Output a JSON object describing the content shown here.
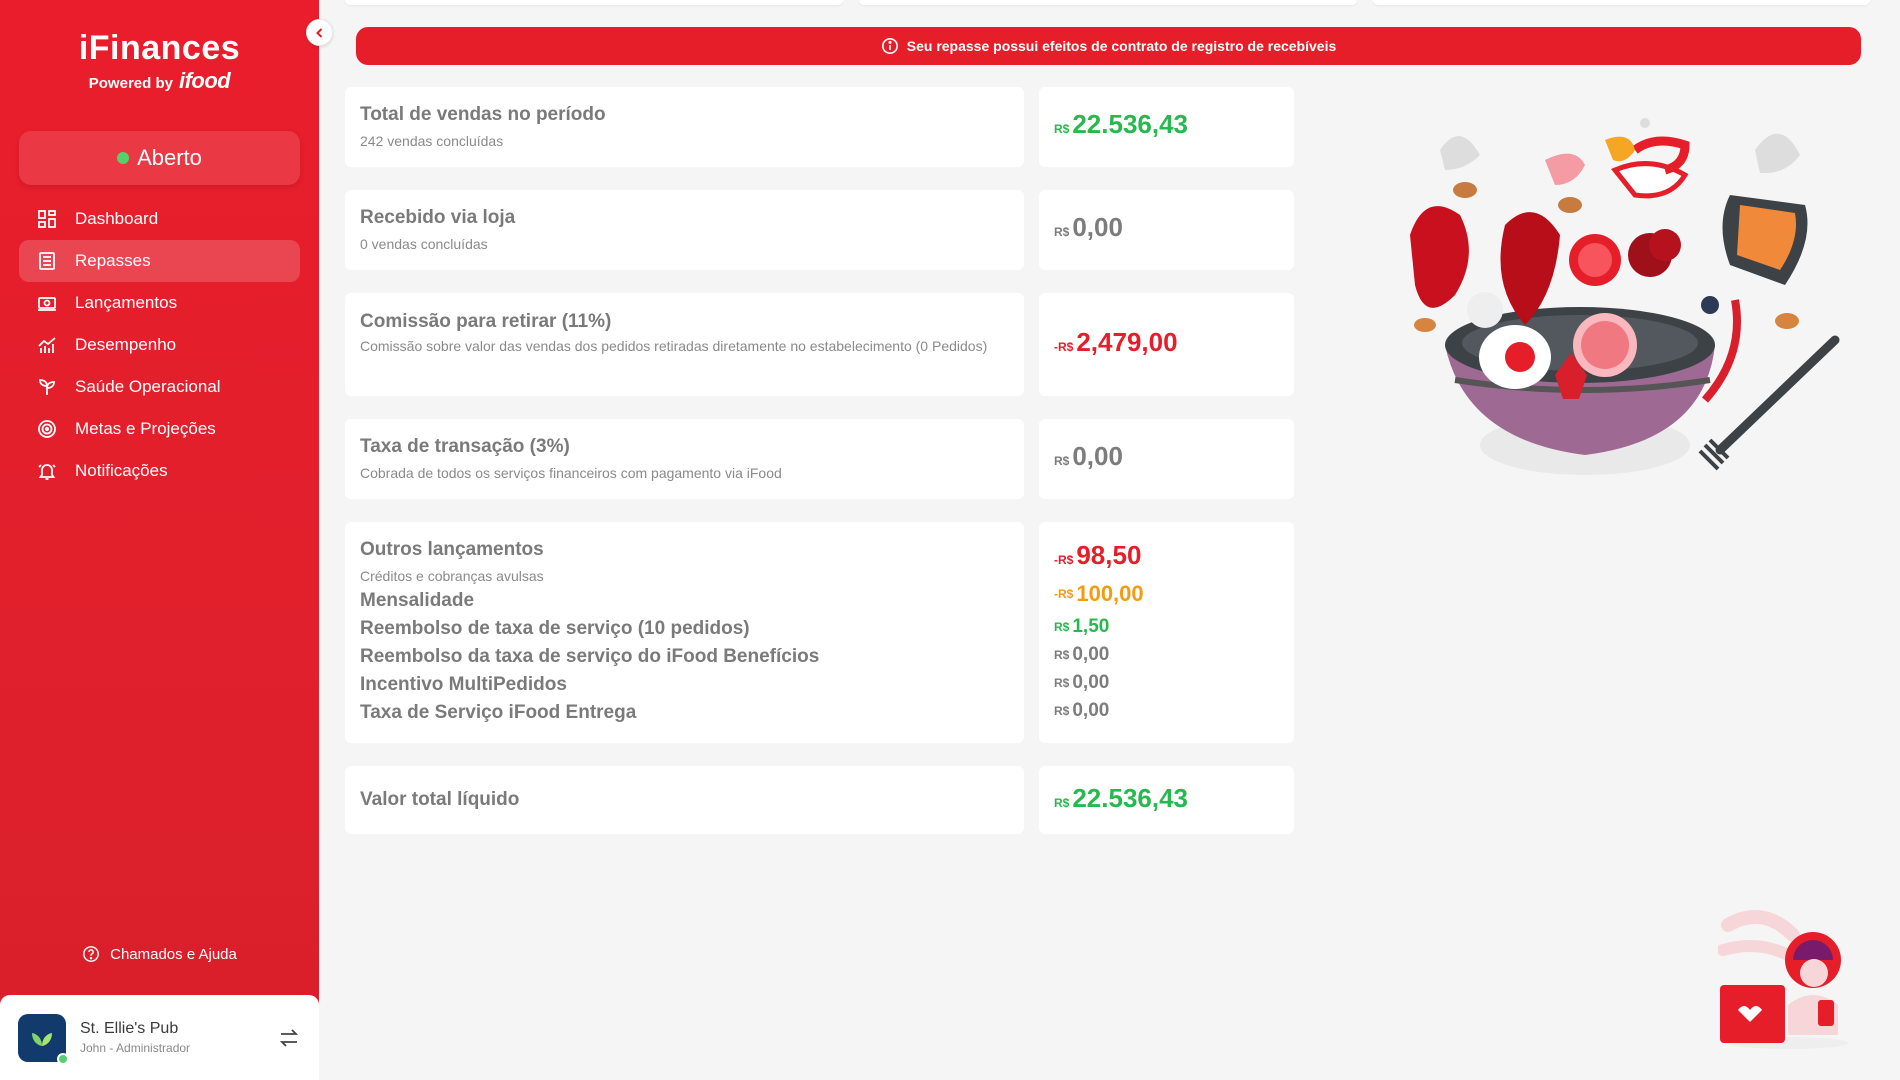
{
  "app": {
    "brand": "iFinances",
    "powered_by": "Powered by",
    "powered_brand": "ifood"
  },
  "sidebar": {
    "status": "Aberto",
    "items": [
      {
        "label": "Dashboard",
        "icon": "dashboard-icon",
        "active": false
      },
      {
        "label": "Repasses",
        "icon": "list-icon",
        "active": true
      },
      {
        "label": "Lançamentos",
        "icon": "money-icon",
        "active": false
      },
      {
        "label": "Desempenho",
        "icon": "chart-icon",
        "active": false
      },
      {
        "label": "Saúde Operacional",
        "icon": "plant-icon",
        "active": false
      },
      {
        "label": "Metas e Projeções",
        "icon": "target-icon",
        "active": false
      },
      {
        "label": "Notificações",
        "icon": "bell-icon",
        "active": false
      }
    ],
    "help": "Chamados e Ajuda",
    "account": {
      "name": "St. Ellie's Pub",
      "role": "John - Administrador"
    }
  },
  "banner": {
    "text": "Seu repasse possui efeitos de contrato de registro de recebíveis"
  },
  "rows": {
    "total_vendas": {
      "title": "Total de vendas no período",
      "sub": "242 vendas concluídas",
      "currency": "R$",
      "value": "22.536,43"
    },
    "recebido_loja": {
      "title": "Recebido via loja",
      "sub": "0 vendas concluídas",
      "currency": "R$",
      "value": "0,00"
    },
    "comissao": {
      "title": "Comissão para retirar (11%)",
      "sub": "Comissão sobre valor das vendas dos pedidos retiradas diretamente no estabelecimento (0 Pedidos)",
      "currency": "-R$",
      "value": "2,479,00"
    },
    "taxa_transacao": {
      "title": "Taxa de transação (3%)",
      "sub": "Cobrada de todos os serviços financeiros com pagamento via iFood",
      "currency": "R$",
      "value": "0,00"
    },
    "outros": {
      "title": "Outros lançamentos",
      "sub": "Créditos e cobranças avulsas",
      "currency": "-R$",
      "value": "98,50",
      "items": [
        {
          "label": "Mensalidade",
          "currency": "-R$",
          "value": "100,00"
        },
        {
          "label": "Reembolso de taxa de serviço (10 pedidos)",
          "currency": "R$",
          "value": "1,50"
        },
        {
          "label": "Reembolso da taxa de serviço do iFood Benefícios",
          "currency": "R$",
          "value": "0,00"
        },
        {
          "label": "Incentivo MultiPedidos",
          "currency": "R$",
          "value": "0,00"
        },
        {
          "label": "Taxa de Serviço iFood Entrega",
          "currency": "R$",
          "value": "0,00"
        }
      ]
    },
    "liquido": {
      "title": "Valor total líquido",
      "currency": "R$",
      "value": "22.536,43"
    }
  },
  "colors": {
    "brand": "#ea1d2c",
    "positive": "#27b94f",
    "negative": "#e51e2a",
    "warning": "#f39c12",
    "neutral": "#7c7c7c"
  }
}
